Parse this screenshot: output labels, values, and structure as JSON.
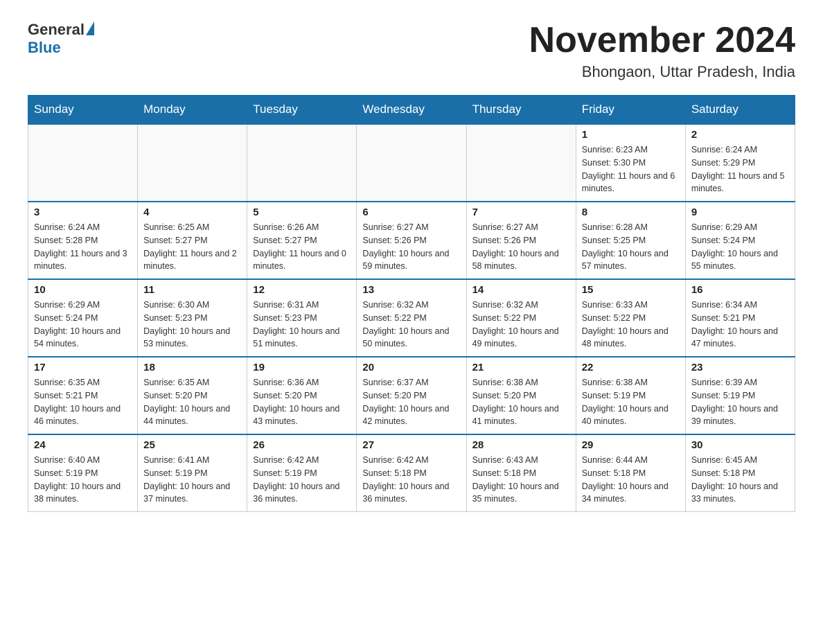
{
  "header": {
    "logo": {
      "general": "General",
      "blue": "Blue"
    },
    "title": "November 2024",
    "subtitle": "Bhongaon, Uttar Pradesh, India"
  },
  "weekdays": [
    "Sunday",
    "Monday",
    "Tuesday",
    "Wednesday",
    "Thursday",
    "Friday",
    "Saturday"
  ],
  "weeks": [
    [
      {
        "day": "",
        "info": ""
      },
      {
        "day": "",
        "info": ""
      },
      {
        "day": "",
        "info": ""
      },
      {
        "day": "",
        "info": ""
      },
      {
        "day": "",
        "info": ""
      },
      {
        "day": "1",
        "info": "Sunrise: 6:23 AM\nSunset: 5:30 PM\nDaylight: 11 hours and 6 minutes."
      },
      {
        "day": "2",
        "info": "Sunrise: 6:24 AM\nSunset: 5:29 PM\nDaylight: 11 hours and 5 minutes."
      }
    ],
    [
      {
        "day": "3",
        "info": "Sunrise: 6:24 AM\nSunset: 5:28 PM\nDaylight: 11 hours and 3 minutes."
      },
      {
        "day": "4",
        "info": "Sunrise: 6:25 AM\nSunset: 5:27 PM\nDaylight: 11 hours and 2 minutes."
      },
      {
        "day": "5",
        "info": "Sunrise: 6:26 AM\nSunset: 5:27 PM\nDaylight: 11 hours and 0 minutes."
      },
      {
        "day": "6",
        "info": "Sunrise: 6:27 AM\nSunset: 5:26 PM\nDaylight: 10 hours and 59 minutes."
      },
      {
        "day": "7",
        "info": "Sunrise: 6:27 AM\nSunset: 5:26 PM\nDaylight: 10 hours and 58 minutes."
      },
      {
        "day": "8",
        "info": "Sunrise: 6:28 AM\nSunset: 5:25 PM\nDaylight: 10 hours and 57 minutes."
      },
      {
        "day": "9",
        "info": "Sunrise: 6:29 AM\nSunset: 5:24 PM\nDaylight: 10 hours and 55 minutes."
      }
    ],
    [
      {
        "day": "10",
        "info": "Sunrise: 6:29 AM\nSunset: 5:24 PM\nDaylight: 10 hours and 54 minutes."
      },
      {
        "day": "11",
        "info": "Sunrise: 6:30 AM\nSunset: 5:23 PM\nDaylight: 10 hours and 53 minutes."
      },
      {
        "day": "12",
        "info": "Sunrise: 6:31 AM\nSunset: 5:23 PM\nDaylight: 10 hours and 51 minutes."
      },
      {
        "day": "13",
        "info": "Sunrise: 6:32 AM\nSunset: 5:22 PM\nDaylight: 10 hours and 50 minutes."
      },
      {
        "day": "14",
        "info": "Sunrise: 6:32 AM\nSunset: 5:22 PM\nDaylight: 10 hours and 49 minutes."
      },
      {
        "day": "15",
        "info": "Sunrise: 6:33 AM\nSunset: 5:22 PM\nDaylight: 10 hours and 48 minutes."
      },
      {
        "day": "16",
        "info": "Sunrise: 6:34 AM\nSunset: 5:21 PM\nDaylight: 10 hours and 47 minutes."
      }
    ],
    [
      {
        "day": "17",
        "info": "Sunrise: 6:35 AM\nSunset: 5:21 PM\nDaylight: 10 hours and 46 minutes."
      },
      {
        "day": "18",
        "info": "Sunrise: 6:35 AM\nSunset: 5:20 PM\nDaylight: 10 hours and 44 minutes."
      },
      {
        "day": "19",
        "info": "Sunrise: 6:36 AM\nSunset: 5:20 PM\nDaylight: 10 hours and 43 minutes."
      },
      {
        "day": "20",
        "info": "Sunrise: 6:37 AM\nSunset: 5:20 PM\nDaylight: 10 hours and 42 minutes."
      },
      {
        "day": "21",
        "info": "Sunrise: 6:38 AM\nSunset: 5:20 PM\nDaylight: 10 hours and 41 minutes."
      },
      {
        "day": "22",
        "info": "Sunrise: 6:38 AM\nSunset: 5:19 PM\nDaylight: 10 hours and 40 minutes."
      },
      {
        "day": "23",
        "info": "Sunrise: 6:39 AM\nSunset: 5:19 PM\nDaylight: 10 hours and 39 minutes."
      }
    ],
    [
      {
        "day": "24",
        "info": "Sunrise: 6:40 AM\nSunset: 5:19 PM\nDaylight: 10 hours and 38 minutes."
      },
      {
        "day": "25",
        "info": "Sunrise: 6:41 AM\nSunset: 5:19 PM\nDaylight: 10 hours and 37 minutes."
      },
      {
        "day": "26",
        "info": "Sunrise: 6:42 AM\nSunset: 5:19 PM\nDaylight: 10 hours and 36 minutes."
      },
      {
        "day": "27",
        "info": "Sunrise: 6:42 AM\nSunset: 5:18 PM\nDaylight: 10 hours and 36 minutes."
      },
      {
        "day": "28",
        "info": "Sunrise: 6:43 AM\nSunset: 5:18 PM\nDaylight: 10 hours and 35 minutes."
      },
      {
        "day": "29",
        "info": "Sunrise: 6:44 AM\nSunset: 5:18 PM\nDaylight: 10 hours and 34 minutes."
      },
      {
        "day": "30",
        "info": "Sunrise: 6:45 AM\nSunset: 5:18 PM\nDaylight: 10 hours and 33 minutes."
      }
    ]
  ]
}
